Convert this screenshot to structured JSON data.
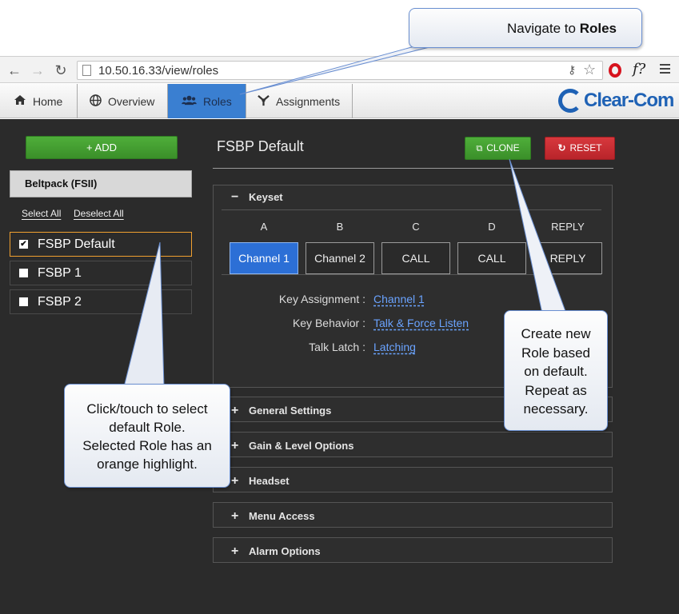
{
  "browser": {
    "back_icon": "arrow-left-icon",
    "forward_icon": "arrow-right-icon",
    "reload_icon": "reload-icon",
    "url": "10.50.16.33/view/roles"
  },
  "tabs": [
    {
      "label": "Home",
      "icon": "home-icon",
      "active": false
    },
    {
      "label": "Overview",
      "icon": "globe-icon",
      "active": false
    },
    {
      "label": "Roles",
      "icon": "users-icon",
      "active": true
    },
    {
      "label": "Assignments",
      "icon": "assignments-icon",
      "active": false
    }
  ],
  "brand": {
    "text": "Clear-Com",
    "color": "#1f62b5"
  },
  "sidebar": {
    "add_label": "+ ADD",
    "device_label": "Beltpack (FSII)",
    "select_all": "Select All",
    "deselect_all": "Deselect All",
    "roles": [
      {
        "label": "FSBP Default",
        "checked": true,
        "selected": true
      },
      {
        "label": "FSBP 1",
        "checked": false,
        "selected": false
      },
      {
        "label": "FSBP 2",
        "checked": false,
        "selected": false
      }
    ]
  },
  "main": {
    "title": "FSBP Default",
    "clone_label": "CLONE",
    "reset_label": "RESET",
    "keyset": {
      "heading": "Keyset",
      "columns": [
        "A",
        "B",
        "C",
        "D",
        "REPLY"
      ],
      "keys": [
        "Channel 1",
        "Channel 2",
        "CALL",
        "CALL",
        "REPLY"
      ],
      "active_key": 0,
      "properties": [
        {
          "label": "Key Assignment :",
          "value": "Channel 1"
        },
        {
          "label": "Key Behavior :",
          "value": "Talk & Force Listen"
        },
        {
          "label": "Talk Latch :",
          "value": "Latching"
        }
      ]
    },
    "sections": [
      "General Settings",
      "Gain & Level Options",
      "Headset",
      "Menu Access",
      "Alarm Options"
    ]
  },
  "callouts": {
    "navigate_prefix": "Navigate to ",
    "navigate_bold": "Roles",
    "select_lines": [
      "Click/touch to select",
      "default Role.",
      "Selected Role has an",
      "orange highlight."
    ],
    "clone_lines": [
      "Create new",
      "Role based",
      "on default.",
      "Repeat as",
      "necessary."
    ]
  },
  "colors": {
    "accent_blue": "#3a7fd1",
    "add_green": "#3a8f29",
    "reset_red": "#b8242a",
    "selected_orange": "#f0a030",
    "link_blue": "#6aa3ff"
  }
}
